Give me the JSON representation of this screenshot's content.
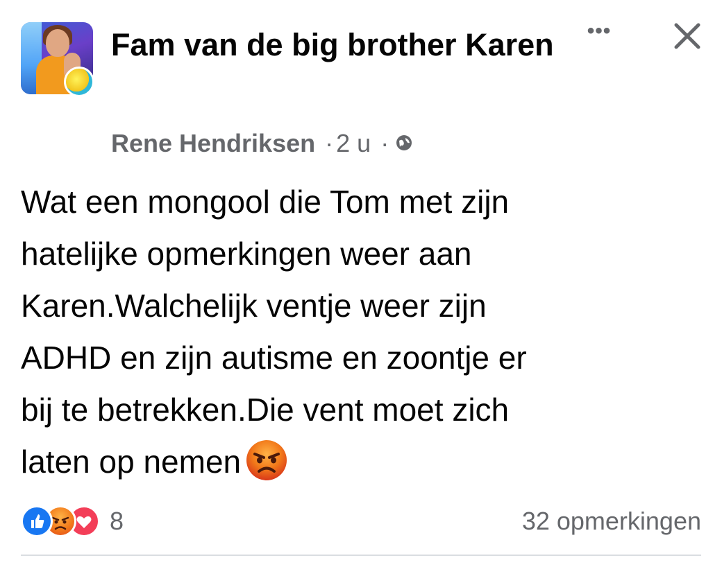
{
  "post": {
    "group_name": "Fam van de big brother Karen",
    "author": "Rene Hendriksen",
    "separator": "·",
    "timestamp": "2 u",
    "privacy_icon": "globe-icon",
    "body_text": "Wat een mongool die Tom met zijn\nhatelijke opmerkingen weer aan\nKaren.Walchelijk ventje weer zijn\nADHD en zijn autisme en zoontje er\nbij te betrekken.Die vent moet zich\nlaten op nemen",
    "body_emoji": "angry-face-emoji",
    "more_options_label": "•••",
    "close_icon": "close-icon"
  },
  "footer": {
    "reactions": [
      "like-reaction-icon",
      "angry-reaction-icon",
      "love-reaction-icon"
    ],
    "reaction_count": "8",
    "comments_label": "32 opmerkingen"
  },
  "colors": {
    "text_primary": "#050505",
    "text_secondary": "#65676b",
    "like_blue": "#1877f2",
    "love_red": "#f33e58",
    "angry_orange": "#f27a1a",
    "divider": "#dadde1"
  }
}
